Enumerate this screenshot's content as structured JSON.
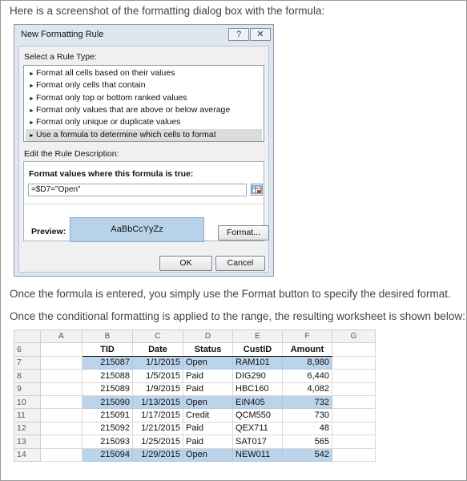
{
  "intro_text": "Here is a screenshot of the formatting dialog box with the formula:",
  "dialog": {
    "title": "New Formatting Rule",
    "help_label": "?",
    "close_label": "✕",
    "select_rule_label": "Select a Rule Type:",
    "rule_types": [
      "Format all cells based on their values",
      "Format only cells that contain",
      "Format only top or bottom ranked values",
      "Format only values that are above or below average",
      "Format only unique or duplicate values",
      "Use a formula to determine which cells to format"
    ],
    "selected_rule_index": 5,
    "edit_desc_label": "Edit the Rule Description:",
    "formula_label": "Format values where this formula is true:",
    "formula_value": "=$D7=\"Open\"",
    "preview_label": "Preview:",
    "preview_text": "AaBbCcYyZz",
    "format_button": "Format...",
    "ok_button": "OK",
    "cancel_button": "Cancel",
    "preview_color": "#b8d2ea"
  },
  "para1": "Once the formula is entered, you simply use the Format button to specify the desired format.",
  "para2": "Once the conditional formatting is applied to the range, the resulting worksheet is shown below:",
  "sheet": {
    "columns": [
      "A",
      "B",
      "C",
      "D",
      "E",
      "F",
      "G"
    ],
    "header_row": "6",
    "headers": [
      "TID",
      "Date",
      "Status",
      "CustID",
      "Amount"
    ],
    "rows": [
      {
        "n": "7",
        "tid": "215087",
        "date": "1/1/2015",
        "status": "Open",
        "cust": "RAM101",
        "amount": "8,980",
        "highlight": true
      },
      {
        "n": "8",
        "tid": "215088",
        "date": "1/5/2015",
        "status": "Paid",
        "cust": "DIG290",
        "amount": "6,440",
        "highlight": false
      },
      {
        "n": "9",
        "tid": "215089",
        "date": "1/9/2015",
        "status": "Paid",
        "cust": "HBC160",
        "amount": "4,082",
        "highlight": false
      },
      {
        "n": "10",
        "tid": "215090",
        "date": "1/13/2015",
        "status": "Open",
        "cust": "EIN405",
        "amount": "732",
        "highlight": true
      },
      {
        "n": "11",
        "tid": "215091",
        "date": "1/17/2015",
        "status": "Credit",
        "cust": "QCM550",
        "amount": "730",
        "highlight": false
      },
      {
        "n": "12",
        "tid": "215092",
        "date": "1/21/2015",
        "status": "Paid",
        "cust": "QEX711",
        "amount": "48",
        "highlight": false
      },
      {
        "n": "13",
        "tid": "215093",
        "date": "1/25/2015",
        "status": "Paid",
        "cust": "SAT017",
        "amount": "565",
        "highlight": false
      },
      {
        "n": "14",
        "tid": "215094",
        "date": "1/29/2015",
        "status": "Open",
        "cust": "NEW011",
        "amount": "542",
        "highlight": true
      }
    ],
    "highlight_color": "#bcd4ea"
  }
}
